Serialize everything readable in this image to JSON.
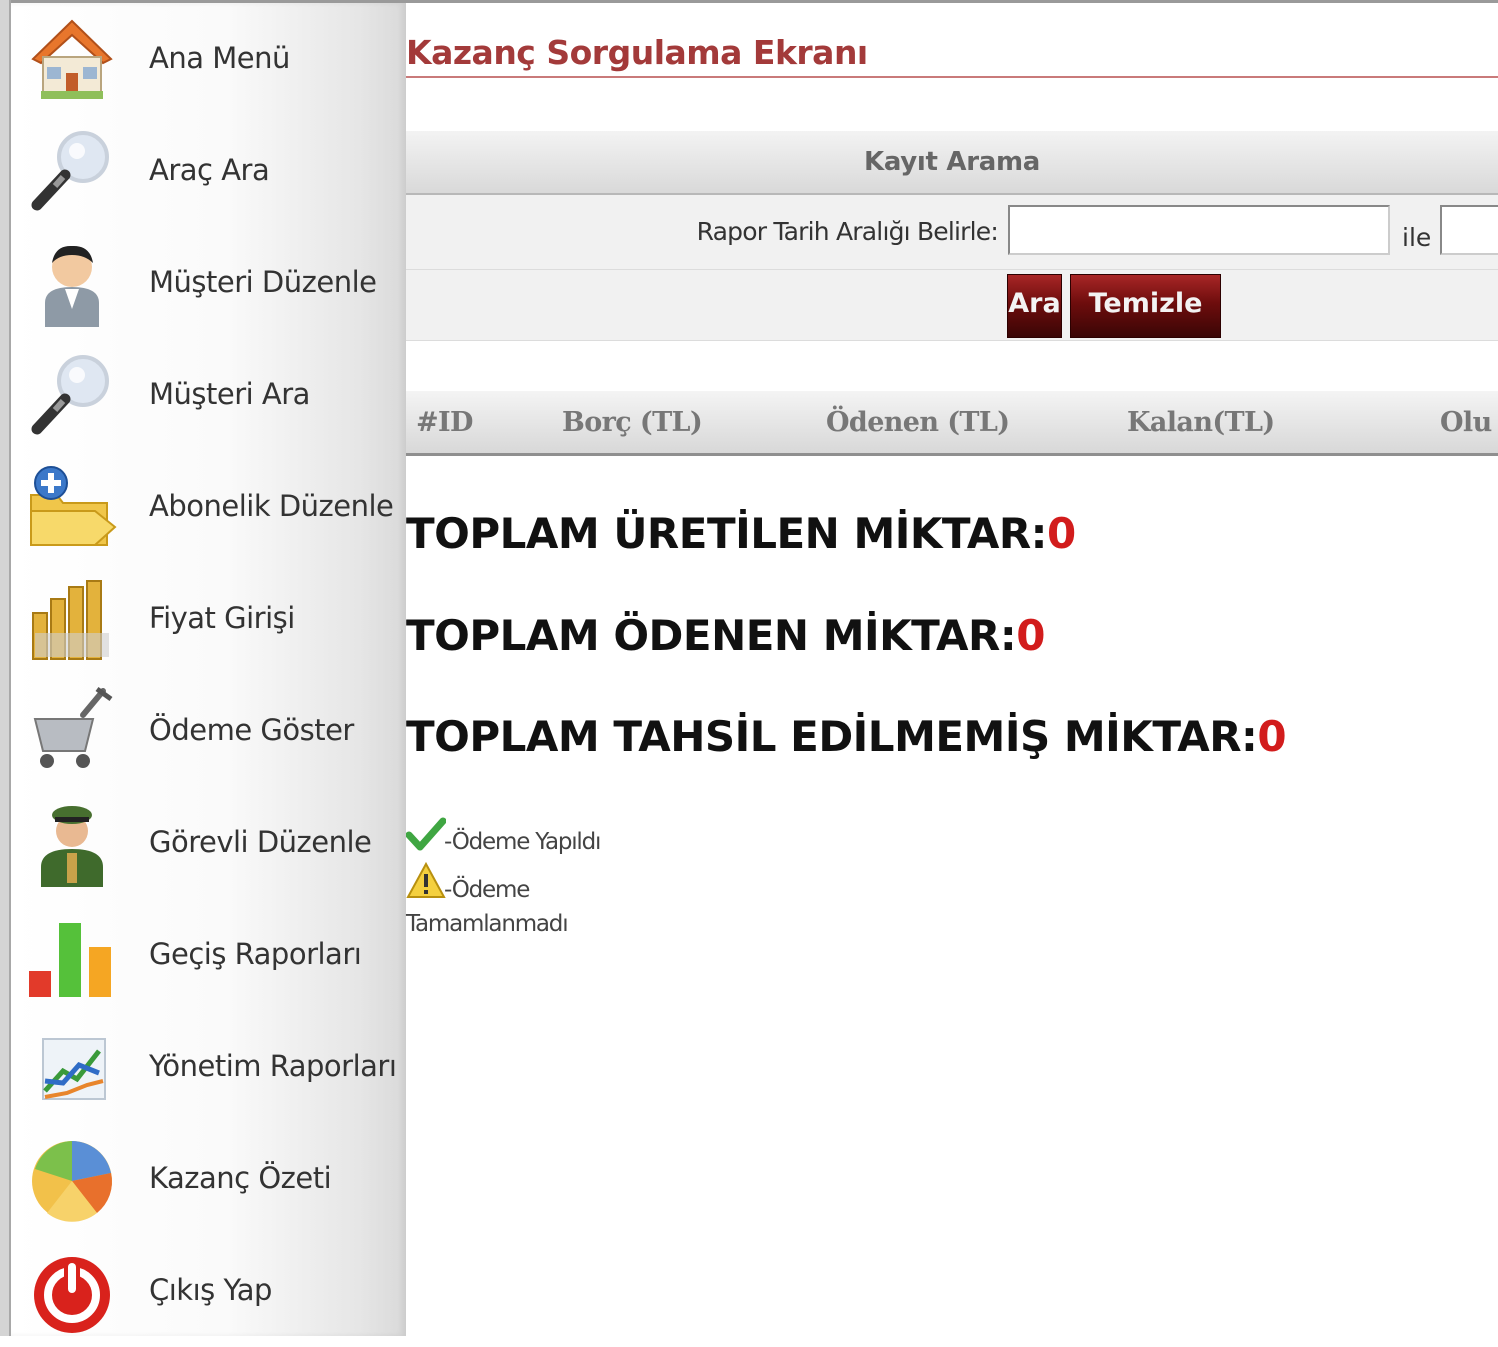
{
  "sidebar": {
    "items": [
      {
        "label": "Ana Menü",
        "icon": "home-icon"
      },
      {
        "label": "Araç Ara",
        "icon": "magnifier-icon"
      },
      {
        "label": "Müşteri Düzenle",
        "icon": "user-icon"
      },
      {
        "label": "Müşteri Ara",
        "icon": "magnifier-icon"
      },
      {
        "label": "Abonelik Düzenle",
        "icon": "folder-add-icon"
      },
      {
        "label": "Fiyat Girişi",
        "icon": "coins-icon"
      },
      {
        "label": "Ödeme Göster",
        "icon": "cart-icon"
      },
      {
        "label": "Görevli Düzenle",
        "icon": "officer-icon"
      },
      {
        "label": "Geçiş Raporları",
        "icon": "bar-chart-icon"
      },
      {
        "label": "Yönetim Raporları",
        "icon": "line-chart-icon"
      },
      {
        "label": "Kazanç Özeti",
        "icon": "pie-chart-icon"
      },
      {
        "label": "Çıkış Yap",
        "icon": "power-icon"
      }
    ]
  },
  "main": {
    "title": "Kazanç Sorgulama Ekranı",
    "search": {
      "header": "Kayıt Arama",
      "date_label": "Rapor Tarih Aralığı Belirle:",
      "date_start_value": "",
      "date_connector": "ile",
      "date_end_value": "",
      "search_button": "Ara",
      "clear_button": "Temizle"
    },
    "table": {
      "columns": [
        "#ID",
        "Borç (TL)",
        "Ödenen (TL)",
        "Kalan(TL)",
        "Olu"
      ]
    },
    "totals": [
      {
        "label": "TOPLAM ÜRETİLEN MİKTAR:",
        "value": "0"
      },
      {
        "label": "TOPLAM ÖDENEN MİKTAR:",
        "value": "0"
      },
      {
        "label": "TOPLAM TAHSİL EDİLMEMİŞ MİKTAR:",
        "value": "0"
      }
    ],
    "legend": {
      "paid": {
        "icon": "checkmark-icon",
        "text": "-Ödeme Yapıldı"
      },
      "unpaid": {
        "icon": "warning-icon",
        "text_line1": "-Ödeme",
        "text_line2": "Tamamlanmadı"
      }
    }
  },
  "colors": {
    "title": "#a33a3a",
    "button": "#6e0d0d",
    "total_value": "#d21c1c"
  }
}
